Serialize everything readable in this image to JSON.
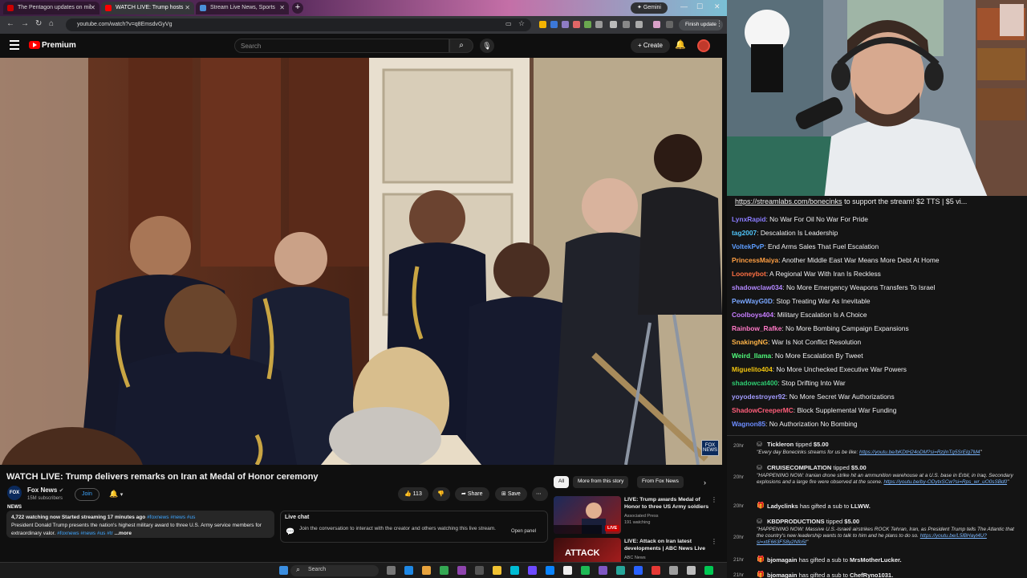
{
  "browser": {
    "tabs": [
      {
        "label": "The Pentagon updates on mil",
        "active": false,
        "color": "#cc0000"
      },
      {
        "label": "WATCH LIVE: Trump hosts",
        "active": true,
        "color": "#ff0000"
      },
      {
        "label": "Stream Live News, Sports",
        "active": false,
        "color": "#4a90d9"
      }
    ],
    "gemini_label": "Gemini",
    "url": "youtube.com/watch?v=q8EmsdvGyVg",
    "finish_update_label": "Finish update"
  },
  "youtube": {
    "brand": "Premium",
    "search_placeholder": "Search",
    "create_label": "Create",
    "video_title": "WATCH LIVE: Trump delivers remarks on Iran at Medal of Honor ceremony",
    "channel": {
      "logo_text": "FOX NEWS",
      "name": "Fox News",
      "subscribers": "15M subscribers"
    },
    "join_label": "Join",
    "like_count": "113",
    "share_label": "Share",
    "save_label": "Save",
    "description": {
      "meta": "4,722 watching now  Started streaming 17 minutes ago",
      "meta_tags": "#foxnews #news #us",
      "text": "President Donald Trump presents the nation's highest military award to three U.S. Army service members for extraordinary valor.",
      "text_tags": "#foxnews #news #us #tr",
      "more": "...more"
    },
    "live_chat": {
      "title": "Live chat",
      "text": "Join the conversation to interact with the creator and others watching this live stream.",
      "open_panel": "Open panel"
    },
    "rec_chips": [
      "All",
      "More from this story",
      "From Fox News"
    ],
    "recommendations": [
      {
        "title": "LIVE: Trump awards Medal of Honor to three US Army soldiers",
        "channel": "Associated Press",
        "meta": "191 watching",
        "badge": "LIVE"
      },
      {
        "title": "LIVE: Attack on Iran latest developments | ABC News Live",
        "channel": "ABC News",
        "meta": "",
        "badge": ""
      }
    ]
  },
  "taskbar": {
    "search_label": "Search"
  },
  "stream_chat": {
    "ticker_link": "https://streamlabs.com/bonecinks",
    "ticker_rest": " to support the stream! $2 TTS | $5 vi...",
    "messages": [
      {
        "user": "LynxRapid",
        "color": "#8a7cff",
        "text": "No War For Oil No War For Pride"
      },
      {
        "user": "tag2007",
        "color": "#4fc3f7",
        "text": "Descalation Is Leadership"
      },
      {
        "user": "VoltekPvP",
        "color": "#5c9dff",
        "text": "End Arms Sales That Fuel Escalation"
      },
      {
        "user": "PrincessMaiya",
        "color": "#ff9f43",
        "text": "Another Middle East War Means More Debt At Home"
      },
      {
        "user": "Looneybot",
        "color": "#ff7043",
        "text": "A Regional War With Iran Is Reckless"
      },
      {
        "user": "shadowclaw034",
        "color": "#b388ff",
        "text": "No More Emergency Weapons Transfers To Israel"
      },
      {
        "user": "PewWayG0D",
        "color": "#7aa7ff",
        "text": "Stop Treating War As Inevitable"
      },
      {
        "user": "Coolboys404",
        "color": "#c77dff",
        "text": "Military Escalation Is A Choice"
      },
      {
        "user": "Rainbow_Rafke",
        "color": "#ff79c6",
        "text": "No More Bombing Campaign Expansions"
      },
      {
        "user": "SnakingNG",
        "color": "#ffb347",
        "text": "War Is Not Conflict Resolution"
      },
      {
        "user": "Weird_llama",
        "color": "#50fa7b",
        "text": "No More Escalation By Tweet"
      },
      {
        "user": "Miguelito404",
        "color": "#f1c40f",
        "text": "No More Unchecked Executive War Powers"
      },
      {
        "user": "shadowcat400",
        "color": "#2ecc71",
        "text": "Stop Drifting Into War"
      },
      {
        "user": "yoyodestroyer92",
        "color": "#a29bfe",
        "text": "No More Secret War Authorizations"
      },
      {
        "user": "ShadowCreeperMC",
        "color": "#ff5e7a",
        "text": "Block Supplemental War Funding"
      },
      {
        "user": "Wagnon85",
        "color": "#6c8cff",
        "text": "No Authorization No Bombing"
      }
    ],
    "events": [
      {
        "time": "20hr",
        "user": "Tickleron",
        "action": "tipped",
        "amount": "$5.00",
        "body": "\"Every day Bonecinks streams for us be like: ",
        "link": "https://youtu.be/bKDtH24oDM?si=RzjInTg5SrElg7M4"
      },
      {
        "time": "20hr",
        "user": "CRUISECOMPILATION",
        "action": "tipped",
        "amount": "$5.00",
        "body": "\"HAPPENING NOW: Iranian drone strike hit an ammunition warehouse at a U.S. base in Erbil, in Iraq. Secondary explosions and a large fire were observed at the scene. ",
        "link": "https://youtu.be/by-ODytxSCw?si=Rps_wr_uO0sSBd0"
      },
      {
        "time": "20hr",
        "user": "Ladyclinks",
        "action": "has gifted a sub to",
        "amount": "LLWW.",
        "body": "",
        "link": ""
      },
      {
        "time": "20hr",
        "user": "KBDPRODUCTIONS",
        "action": "tipped",
        "amount": "$5.00",
        "body": "\"HAPPENING NOW: Massive U.S.-Israeli airstrikes ROCK Tehran, Iran, as President Trump tells The Atlantic that the country's new leadership wants to talk to him and he plans to do so. ",
        "link": "https://youtu.be/L5lBHayt4U?si=xtE663FS8y2Nfo5t"
      },
      {
        "time": "21hr",
        "user": "bjomagain",
        "action": "has gifted a sub to",
        "amount": "MrsMotherLucker.",
        "body": "",
        "link": ""
      },
      {
        "time": "21hr",
        "user": "bjomagain",
        "action": "has gifted a sub to",
        "amount": "ChefRyno1031.",
        "body": "",
        "link": ""
      }
    ]
  }
}
